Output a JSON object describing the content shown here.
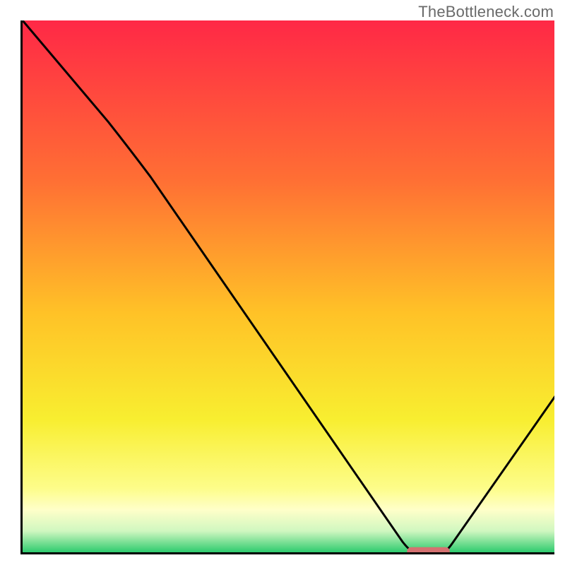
{
  "attribution": "TheBottleneck.com",
  "chart_data": {
    "type": "line",
    "title": "",
    "xlabel": "",
    "ylabel": "",
    "xlim": [
      0,
      100
    ],
    "ylim": [
      0,
      100
    ],
    "grid": false,
    "legend": false,
    "series": [
      {
        "name": "bottleneck-curve",
        "x": [
          0,
          20,
          73,
          79,
          100
        ],
        "y": [
          100,
          76,
          0,
          0,
          30
        ]
      }
    ],
    "marker": {
      "name": "optimal-range",
      "x_range": [
        72,
        80
      ],
      "y": 0.5,
      "color": "#d57171"
    },
    "background": {
      "type": "vertical-gradient",
      "stops": [
        {
          "offset": 0.0,
          "color": "#ff2846"
        },
        {
          "offset": 0.3,
          "color": "#ff6f34"
        },
        {
          "offset": 0.55,
          "color": "#ffc227"
        },
        {
          "offset": 0.75,
          "color": "#f8ee30"
        },
        {
          "offset": 0.88,
          "color": "#fdfd8a"
        },
        {
          "offset": 0.92,
          "color": "#ffffc9"
        },
        {
          "offset": 0.96,
          "color": "#d0f7c0"
        },
        {
          "offset": 1.0,
          "color": "#2ecb6e"
        }
      ]
    }
  }
}
